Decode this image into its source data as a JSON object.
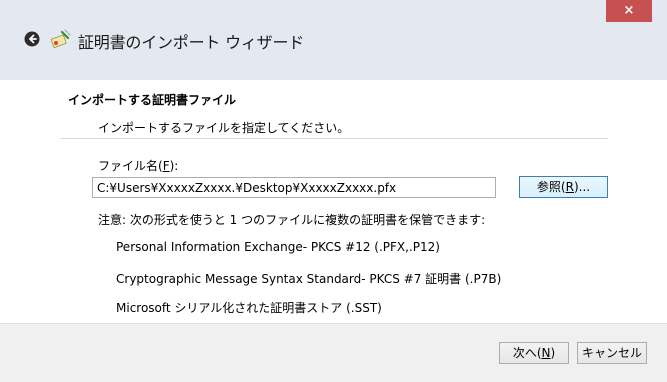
{
  "window": {
    "title": "証明書のインポート ウィザード",
    "close_label": "×"
  },
  "section": {
    "title": "インポートする証明書ファイル",
    "description": "インポートするファイルを指定してください。"
  },
  "file": {
    "label_prefix": "ファイル名(",
    "label_accel": "F",
    "label_suffix": "):",
    "value": "C:¥Users¥XxxxxZxxxx.¥Desktop¥XxxxxZxxxx.pfx",
    "browse_prefix": "参照(",
    "browse_accel": "R",
    "browse_suffix": ")..."
  },
  "note": "注意: 次の形式を使うと 1 つのファイルに複数の証明書を保管できます:",
  "formats": [
    "Personal Information Exchange- PKCS #12 (.PFX,.P12)",
    "Cryptographic Message Syntax Standard- PKCS #7 証明書 (.P7B)",
    "Microsoft シリアル化された証明書ストア (.SST)"
  ],
  "buttons": {
    "next_prefix": "次へ(",
    "next_accel": "N",
    "next_suffix": ")",
    "cancel": "キャンセル"
  },
  "colors": {
    "close_button": "#c75050",
    "header_bg": "#e4e9f1",
    "footer_bg": "#f0f0f0",
    "focus_border": "#3c7fb1"
  },
  "icons": {
    "back": "back-arrow-icon",
    "wizard": "certificate-wizard-icon"
  }
}
